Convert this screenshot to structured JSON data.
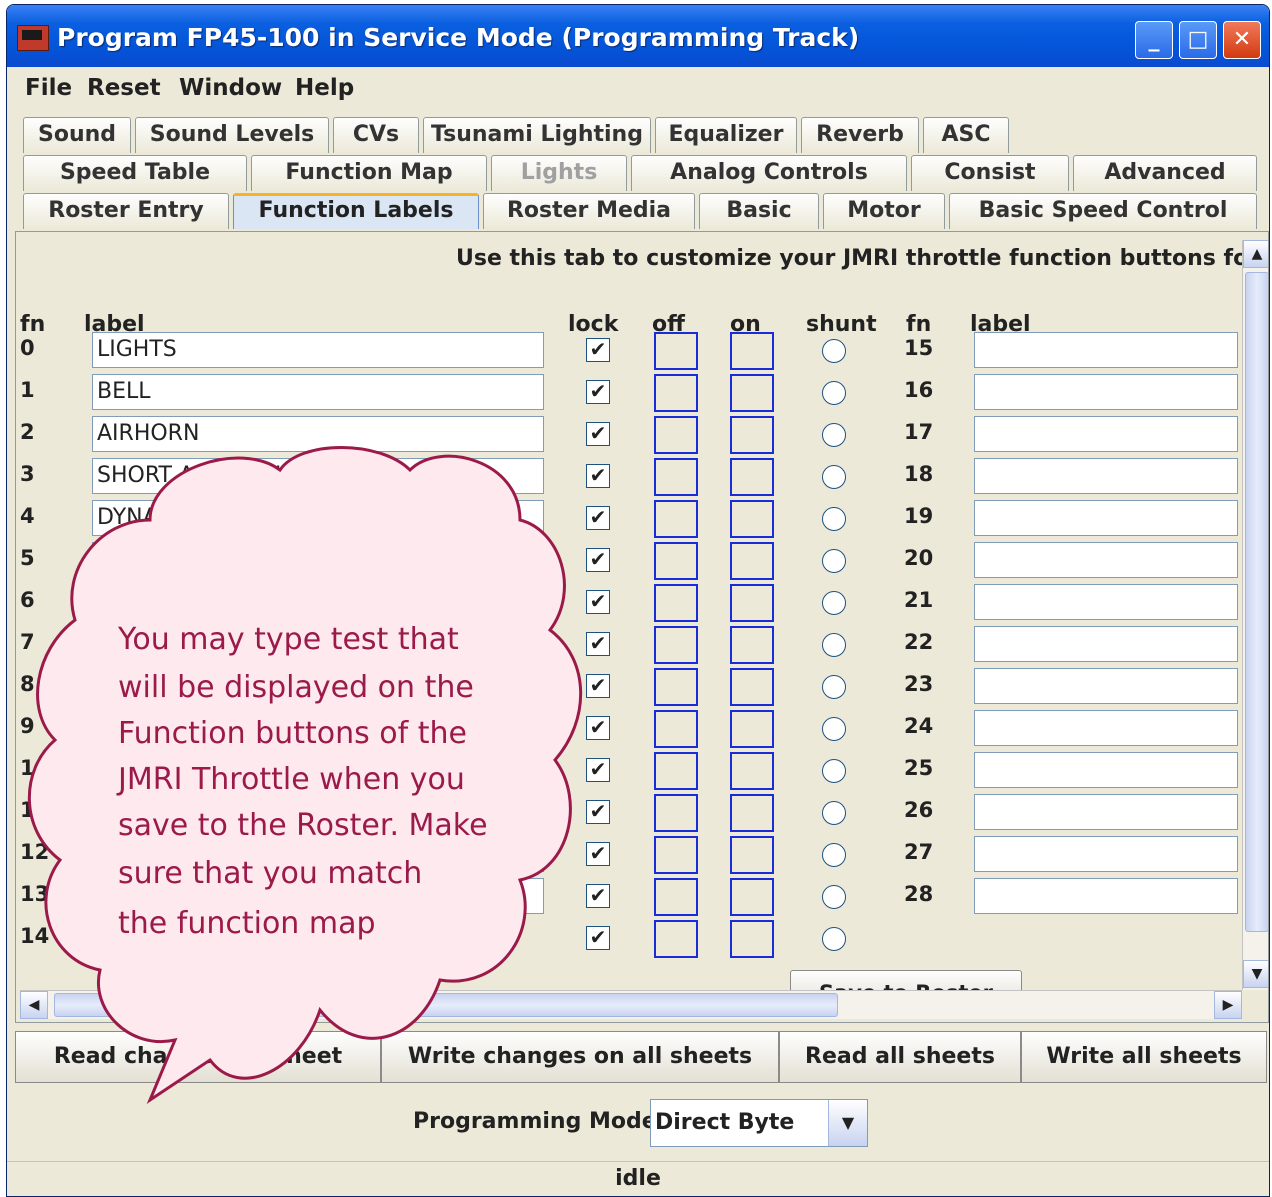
{
  "window": {
    "title": "Program FP45-100 in Service Mode (Programming Track)"
  },
  "menu": [
    "File",
    "Reset",
    "Window",
    "Help"
  ],
  "tabs": {
    "row1": [
      "Sound",
      "Sound Levels",
      "CVs",
      "Tsunami Lighting",
      "Equalizer",
      "Reverb",
      "ASC"
    ],
    "row2": [
      "Speed Table",
      "Function Map",
      "Lights",
      "Analog Controls",
      "Consist",
      "Advanced"
    ],
    "row3": [
      "Roster Entry",
      "Function Labels",
      "Roster Media",
      "Basic",
      "Motor",
      "Basic Speed Control"
    ],
    "active": "Function Labels"
  },
  "panel": {
    "hint": "Use this tab to customize your JMRI throttle function buttons for this",
    "headers": {
      "fn": "fn",
      "label": "label",
      "lock": "lock",
      "off": "off",
      "on": "on",
      "shunt": "shunt",
      "fn2": "fn",
      "label2": "label"
    },
    "rows_left": [
      {
        "fn": "0",
        "label": "LIGHTS",
        "lock": true
      },
      {
        "fn": "1",
        "label": "BELL",
        "lock": true
      },
      {
        "fn": "2",
        "label": "AIRHORN",
        "lock": true
      },
      {
        "fn": "3",
        "label": "SHORT AIRHORN",
        "lock": true
      },
      {
        "fn": "4",
        "label": "DYNA",
        "lock": true
      },
      {
        "fn": "5",
        "label": "",
        "lock": true
      },
      {
        "fn": "6",
        "label": "",
        "lock": true
      },
      {
        "fn": "7",
        "label": "",
        "lock": true
      },
      {
        "fn": "8",
        "label": "",
        "lock": true
      },
      {
        "fn": "9",
        "label": "",
        "lock": true
      },
      {
        "fn": "10",
        "label": "",
        "lock": true
      },
      {
        "fn": "11",
        "label": "",
        "lock": true
      },
      {
        "fn": "12",
        "label": "",
        "lock": true
      },
      {
        "fn": "13",
        "label": "",
        "lock": true
      },
      {
        "fn": "14",
        "label": "",
        "lock": true
      }
    ],
    "rows_right": [
      "15",
      "16",
      "17",
      "18",
      "19",
      "20",
      "21",
      "22",
      "23",
      "24",
      "25",
      "26",
      "27",
      "28"
    ],
    "save_button": "Save to Roster",
    "check_glyph": "✔"
  },
  "buttons": {
    "read_changes": "Read changes on sheet",
    "write_changes_all": "Write changes on all sheets",
    "read_all": "Read all sheets",
    "write_all": "Write all sheets"
  },
  "programming": {
    "label": "Programming Mode",
    "mode": "Direct Byte"
  },
  "status": "idle",
  "callout": {
    "lines": [
      "You may type test that",
      "will be displayed on the",
      "Function buttons of the",
      "JMRI Throttle when you",
      "save to the Roster.  Make",
      "sure that you match",
      "the function map"
    ],
    "color": "#9b1a4a",
    "fill": "#fde9ee"
  }
}
